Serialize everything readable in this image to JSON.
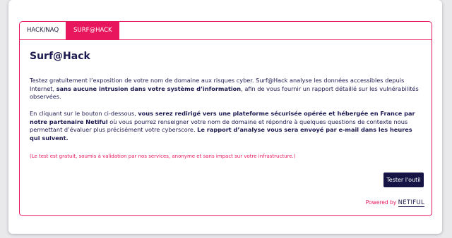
{
  "tabs": [
    {
      "label": "HACK/NAQ",
      "active": false
    },
    {
      "label": "SURF@HACK",
      "active": true
    }
  ],
  "content": {
    "title": "Surf@Hack",
    "p1": {
      "t1": "Testez gratuitement l’exposition de votre nom de domaine aux risques cyber. Surf@Hack analyse les données accessibles depuis Internet, ",
      "b1": "sans aucune intrusion dans votre système d’information",
      "t2": ", afin de vous fournir un rapport détaillé sur les vulnérabilités observées."
    },
    "p2": {
      "t1": "En cliquant sur le bouton ci-dessous, ",
      "b1": "vous serez redirigé vers une plateforme sécurisée opérée et hébergée en France par notre partenaire Netiful",
      "t2": " où vous pourrez renseigner votre nom de domaine et répondre à quelques questions de contexte nous permettant d’évaluer plus précisément votre cyberscore. ",
      "b2": "Le rapport d’analyse vous sera envoyé par e-mail dans les heures qui suivent."
    },
    "note": "(Le test est gratuit, soumis à validation par nos services, anonyme et sans impact sur votre infrastructure.)",
    "button_label": "Tester l'outil",
    "powered_label": "Powered by",
    "brand": "NETIFUL"
  },
  "colors": {
    "accent": "#e8175d",
    "navy": "#1c1950",
    "button": "#161445"
  }
}
